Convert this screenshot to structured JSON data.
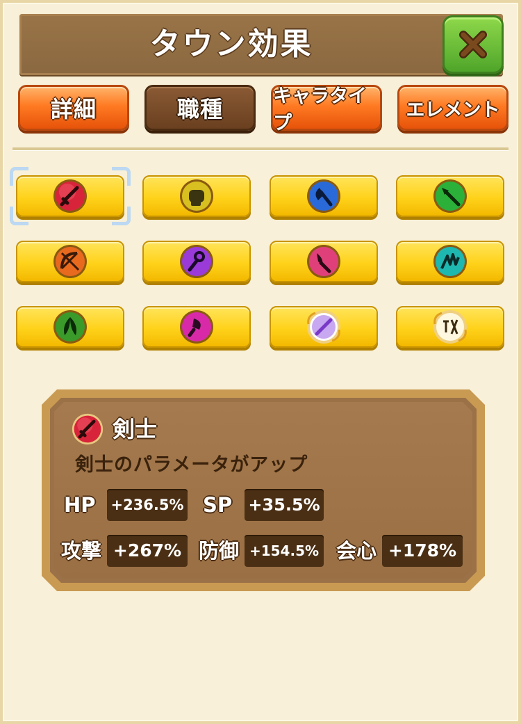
{
  "header": {
    "title": "タウン効果",
    "close_icon": "close-x-icon"
  },
  "tabs": [
    {
      "label": "詳細",
      "active": false
    },
    {
      "label": "職種",
      "active": true
    },
    {
      "label": "キャラタイプ",
      "active": false
    },
    {
      "label": "エレメント",
      "active": false
    }
  ],
  "jobs": [
    {
      "icon": "sword-icon",
      "color": "#d8243a",
      "selected": true
    },
    {
      "icon": "fist-icon",
      "color": "#c9b200",
      "selected": false
    },
    {
      "icon": "axe-icon",
      "color": "#2a6ad8",
      "selected": false
    },
    {
      "icon": "spear-icon",
      "color": "#2bb13a",
      "selected": false
    },
    {
      "icon": "bow-icon",
      "color": "#e86a1e",
      "selected": false
    },
    {
      "icon": "staff-icon",
      "color": "#9a3ad8",
      "selected": false
    },
    {
      "icon": "dagger-icon",
      "color": "#e0407a",
      "selected": false
    },
    {
      "icon": "claw-icon",
      "color": "#1eb8b0",
      "selected": false
    },
    {
      "icon": "leaf-icon",
      "color": "#3a9a2a",
      "selected": false
    },
    {
      "icon": "wand-icon",
      "color": "#d82aa8",
      "selected": false
    },
    {
      "icon": "special-sword-badge-icon",
      "color": "#9a6ad8",
      "selected": false
    },
    {
      "icon": "secret-badge-icon",
      "color": "#e0a020",
      "selected": false
    }
  ],
  "info": {
    "name": "剣士",
    "icon": "sword-icon",
    "description": "剣士のパラメータがアップ",
    "stats": [
      {
        "label": "HP",
        "value": "+236.5%"
      },
      {
        "label": "SP",
        "value": "+35.5%"
      },
      {
        "label": "攻撃",
        "value": "+267%"
      },
      {
        "label": "防御",
        "value": "+154.5%"
      },
      {
        "label": "会心",
        "value": "+178%"
      }
    ]
  },
  "colors": {
    "title_bar": "#8a6840",
    "tab_orange": "#ff7a22",
    "tab_active": "#6a4020",
    "job_button": "#ffd21a",
    "close_green": "#4fa52a",
    "panel": "#9b7147"
  }
}
